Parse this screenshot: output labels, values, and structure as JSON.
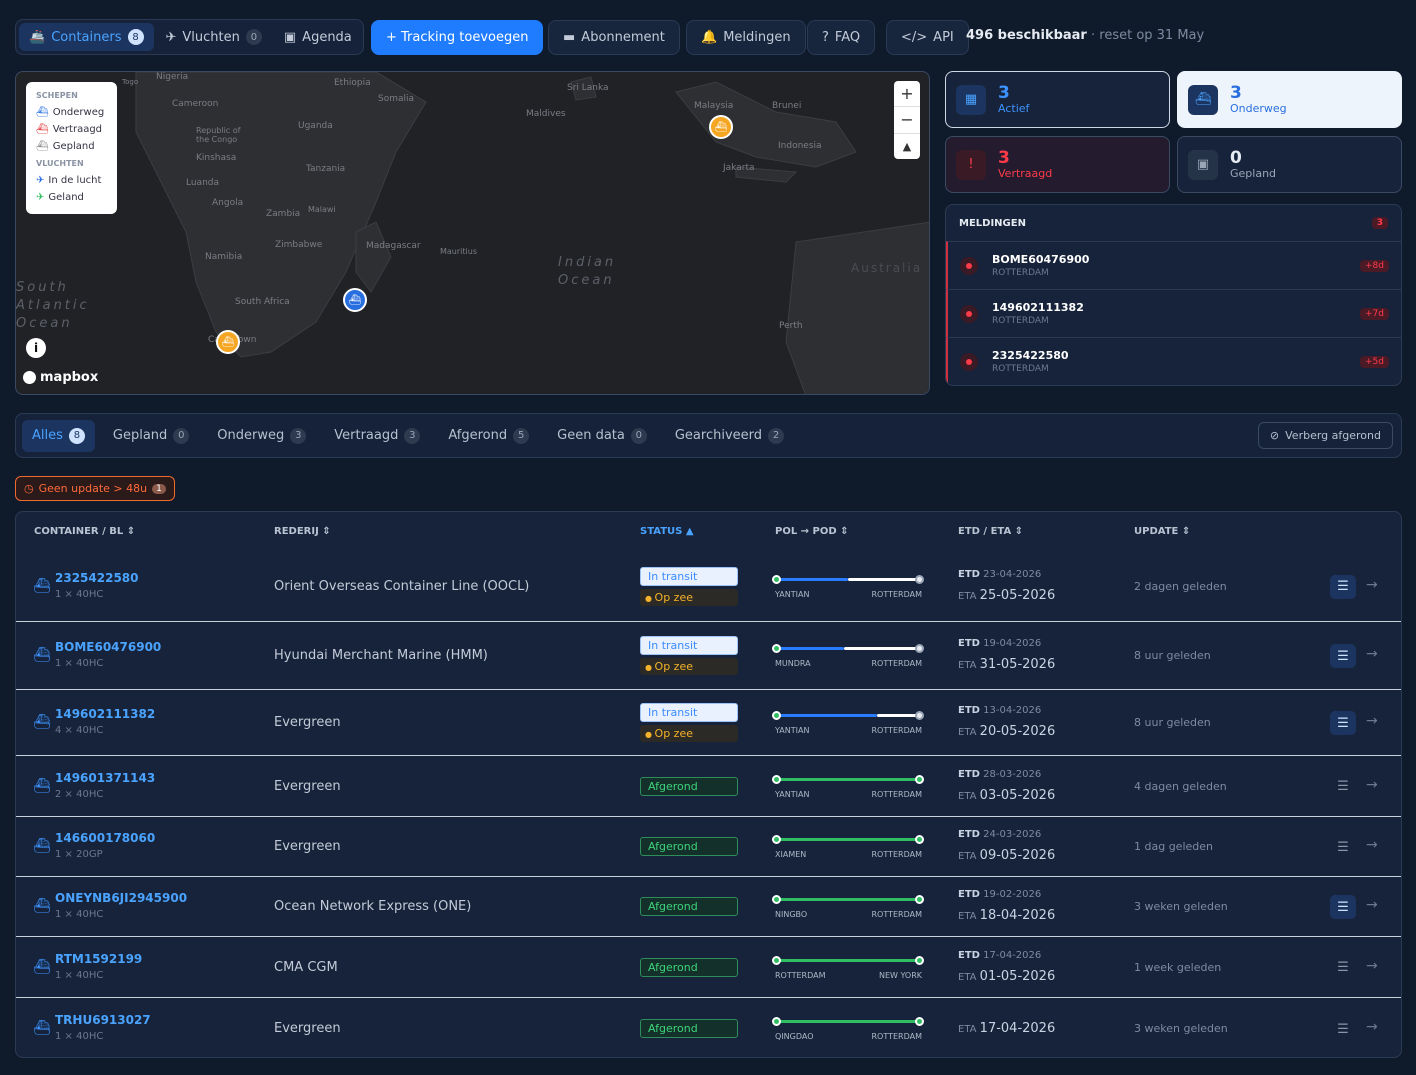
{
  "nav": {
    "containers": {
      "label": "Containers",
      "count": "8"
    },
    "vluchten": {
      "label": "Vluchten",
      "count": "0"
    },
    "agenda": {
      "label": "Agenda"
    },
    "add_tracking": "+ Tracking toevoegen",
    "abonnement": "Abonnement",
    "meldingen": "Meldingen",
    "faq": "FAQ",
    "api": "API",
    "available": "496 beschikbaar",
    "reset": " · reset op 31 May"
  },
  "map": {
    "legend": {
      "schepen_title": "SCHEPEN",
      "onderweg": "Onderweg",
      "vertraagd": "Vertraagd",
      "gepland": "Gepland",
      "vluchten_title": "VLUCHTEN",
      "in_de_lucht": "In de lucht",
      "geland": "Geland"
    },
    "labels": [
      "Nigeria",
      "Ethiopia",
      "Somalia",
      "Sri Lanka",
      "Malaysia",
      "Brunei",
      "Cameroon",
      "Maldives",
      "Uganda",
      "Indonesia",
      "Republic of the Congo",
      "Kinshasa",
      "Tanzania",
      "Jakarta",
      "Luanda",
      "Angola",
      "Zambia",
      "Malawi",
      "Zimbabwe",
      "Madagascar",
      "Mauritius",
      "Namibia",
      "South Africa",
      "Perth",
      "Cape Town",
      "Togo",
      "Australia"
    ],
    "oceans": {
      "indian": "Indian\nOcean",
      "atlantic": "South\nAtlantic\nOcean"
    },
    "attribution": "mapbox"
  },
  "stats": {
    "actief": {
      "num": "3",
      "label": "Actief"
    },
    "onderweg": {
      "num": "3",
      "label": "Onderweg"
    },
    "vertraagd": {
      "num": "3",
      "label": "Vertraagd"
    },
    "gepland": {
      "num": "0",
      "label": "Gepland"
    }
  },
  "meldingen": {
    "title": "MELDINGEN",
    "count": "3",
    "items": [
      {
        "id": "BOME60476900",
        "port": "ROTTERDAM",
        "days": "+8d"
      },
      {
        "id": "149602111382",
        "port": "ROTTERDAM",
        "days": "+7d"
      },
      {
        "id": "2325422580",
        "port": "ROTTERDAM",
        "days": "+5d"
      }
    ]
  },
  "filters": {
    "tabs": [
      {
        "label": "Alles",
        "count": "8"
      },
      {
        "label": "Gepland",
        "count": "0"
      },
      {
        "label": "Onderweg",
        "count": "3"
      },
      {
        "label": "Vertraagd",
        "count": "3"
      },
      {
        "label": "Afgerond",
        "count": "5"
      },
      {
        "label": "Geen data",
        "count": "0"
      },
      {
        "label": "Gearchiveerd",
        "count": "2"
      }
    ],
    "hide_done": "Verberg afgerond",
    "warning": "Geen update > 48u",
    "warning_count": "1"
  },
  "table": {
    "headers": {
      "container": "CONTAINER / BL",
      "rederij": "REDERIJ",
      "status": "STATUS",
      "route": "POL → POD",
      "dates": "ETD / ETA",
      "update": "UPDATE"
    },
    "rows": [
      {
        "id": "2325422580",
        "qty": "1 × 40HC",
        "carrier": "Orient Overseas Container Line (OOCL)",
        "status": "In transit",
        "sub": "Op zee",
        "progress": 0.5,
        "pol": "YANTIAN",
        "pod": "ROTTERDAM",
        "etd": "23-04-2026",
        "eta": "25-05-2026",
        "update": "2 dagen geleden",
        "alert": true
      },
      {
        "id": "BOME60476900",
        "qty": "1 × 40HC",
        "carrier": "Hyundai Merchant Marine (HMM)",
        "status": "In transit",
        "sub": "Op zee",
        "progress": 0.47,
        "pol": "MUNDRA",
        "pod": "ROTTERDAM",
        "etd": "19-04-2026",
        "eta": "31-05-2026",
        "update": "8 uur geleden",
        "alert": true
      },
      {
        "id": "149602111382",
        "qty": "4 × 40HC",
        "carrier": "Evergreen",
        "status": "In transit",
        "sub": "Op zee",
        "progress": 0.7,
        "pol": "YANTIAN",
        "pod": "ROTTERDAM",
        "etd": "13-04-2026",
        "eta": "20-05-2026",
        "update": "8 uur geleden",
        "alert": true
      },
      {
        "id": "149601371143",
        "qty": "2 × 40HC",
        "carrier": "Evergreen",
        "status": "Afgerond",
        "progress": 1,
        "pol": "YANTIAN",
        "pod": "ROTTERDAM",
        "etd": "28-03-2026",
        "eta": "03-05-2026",
        "update": "4 dagen geleden",
        "alert": false
      },
      {
        "id": "146600178060",
        "qty": "1 × 20GP",
        "carrier": "Evergreen",
        "status": "Afgerond",
        "progress": 1,
        "pol": "XIAMEN",
        "pod": "ROTTERDAM",
        "etd": "24-03-2026",
        "eta": "09-05-2026",
        "update": "1 dag geleden",
        "alert": false
      },
      {
        "id": "ONEYNB6JI2945900",
        "qty": "1 × 40HC",
        "carrier": "Ocean Network Express (ONE)",
        "status": "Afgerond",
        "progress": 1,
        "pol": "NINGBO",
        "pod": "ROTTERDAM",
        "etd": "19-02-2026",
        "eta": "18-04-2026",
        "update": "3 weken geleden",
        "alert": true
      },
      {
        "id": "RTM1592199",
        "qty": "1 × 40HC",
        "carrier": "CMA CGM",
        "status": "Afgerond",
        "progress": 1,
        "pol": "ROTTERDAM",
        "pod": "NEW YORK",
        "etd": "17-04-2026",
        "eta": "01-05-2026",
        "update": "1 week geleden",
        "alert": false
      },
      {
        "id": "TRHU6913027",
        "qty": "1 × 40HC",
        "carrier": "Evergreen",
        "status": "Afgerond",
        "progress": 1,
        "pol": "QINGDAO",
        "pod": "ROTTERDAM",
        "etd": "",
        "eta": "17-04-2026",
        "update": "3 weken geleden",
        "alert": false
      }
    ]
  }
}
